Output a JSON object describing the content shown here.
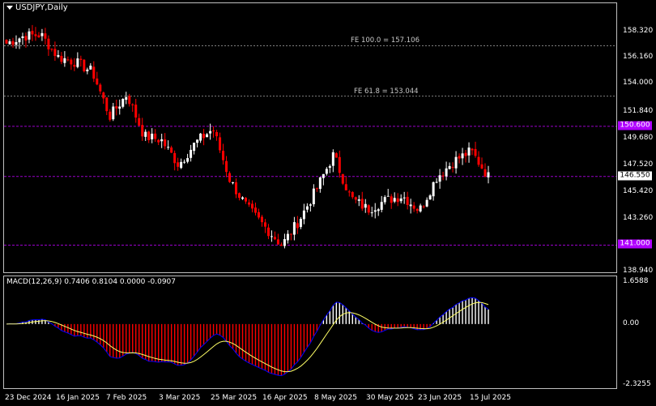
{
  "chart": {
    "symbol": "USDJPY,Daily",
    "macd_label": "MACD(12,26,9) 0.7406 0.8104 0.0000 -0.0907",
    "colors": {
      "background": "#000000",
      "bull_candle": "#ffffff",
      "bear_candle": "#ff0000",
      "level_line": "#9900cc",
      "level_tag": "#b000ff",
      "fib_line": "#808080",
      "macd_main": "#0000ff",
      "macd_signal": "#ffff66",
      "hist_pos": "#ffffff",
      "hist_neg": "#ff0000"
    }
  },
  "price_axis": [
    "158.320",
    "156.160",
    "154.000",
    "151.840",
    "149.680",
    "147.520",
    "145.420",
    "143.260",
    "138.940"
  ],
  "price_tags": [
    {
      "value": "150.600",
      "type": "level"
    },
    {
      "value": "146.550",
      "type": "current"
    },
    {
      "value": "141.000",
      "type": "level"
    }
  ],
  "fib_levels": [
    {
      "label": "FE 100.0 = 157.106",
      "price": 157.106
    },
    {
      "label": "FE 61.8 = 153.044",
      "price": 153.044
    }
  ],
  "macd_axis": [
    "1.6588",
    "0.00",
    "-2.3255"
  ],
  "date_axis": [
    "23 Dec 2024",
    "16 Jan 2025",
    "7 Feb 2025",
    "3 Mar 2025",
    "25 Mar 2025",
    "16 Apr 2025",
    "8 May 2025",
    "30 May 2025",
    "23 Jun 2025",
    "15 Jul 2025"
  ],
  "chart_data": {
    "type": "candlestick",
    "title": "USDJPY,Daily",
    "ylim": [
      138.94,
      158.32
    ],
    "horizontal_levels": [
      150.6,
      146.55,
      141.0
    ],
    "close_path": [
      {
        "date": "23 Dec 2024",
        "close": 157.3
      },
      {
        "date": "1 Jan 2025",
        "close": 157.9
      },
      {
        "date": "10 Jan 2025",
        "close": 158.0
      },
      {
        "date": "16 Jan 2025",
        "close": 156.2
      },
      {
        "date": "24 Jan 2025",
        "close": 155.8
      },
      {
        "date": "31 Jan 2025",
        "close": 155.0
      },
      {
        "date": "7 Feb 2025",
        "close": 151.4
      },
      {
        "date": "13 Feb 2025",
        "close": 153.2
      },
      {
        "date": "20 Feb 2025",
        "close": 149.8
      },
      {
        "date": "3 Mar 2025",
        "close": 149.5
      },
      {
        "date": "11 Mar 2025",
        "close": 147.5
      },
      {
        "date": "18 Mar 2025",
        "close": 149.3
      },
      {
        "date": "25 Mar 2025",
        "close": 150.4
      },
      {
        "date": "3 Apr 2025",
        "close": 146.2
      },
      {
        "date": "10 Apr 2025",
        "close": 144.0
      },
      {
        "date": "16 Apr 2025",
        "close": 142.5
      },
      {
        "date": "22 Apr 2025",
        "close": 141.0
      },
      {
        "date": "30 Apr 2025",
        "close": 143.0
      },
      {
        "date": "8 May 2025",
        "close": 145.5
      },
      {
        "date": "12 May 2025",
        "close": 148.3
      },
      {
        "date": "20 May 2025",
        "close": 144.8
      },
      {
        "date": "30 May 2025",
        "close": 143.9
      },
      {
        "date": "10 Jun 2025",
        "close": 144.6
      },
      {
        "date": "23 Jun 2025",
        "close": 145.0
      },
      {
        "date": "1 Jul 2025",
        "close": 143.8
      },
      {
        "date": "8 Jul 2025",
        "close": 146.5
      },
      {
        "date": "15 Jul 2025",
        "close": 147.8
      },
      {
        "date": "18 Jul 2025",
        "close": 148.6
      },
      {
        "date": "22 Jul 2025",
        "close": 146.55
      }
    ],
    "macd": {
      "ylim": [
        -2.3255,
        1.6588
      ],
      "last_main": 0.7406,
      "last_signal": 0.8104
    }
  }
}
